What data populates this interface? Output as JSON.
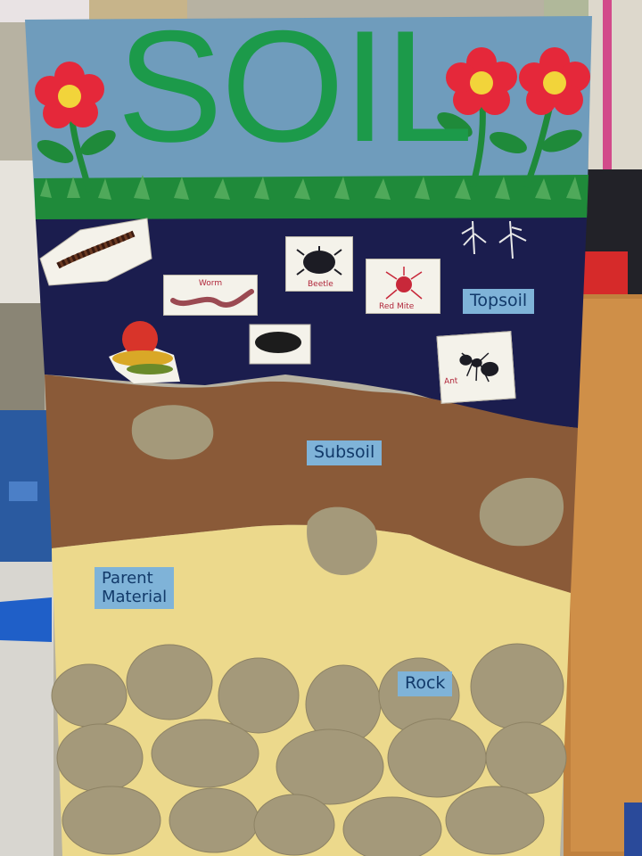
{
  "board": {
    "title": "SOIL"
  },
  "layers": {
    "topsoil": "Topsoil",
    "subsoil": "Subsoil",
    "parent_material": "Parent\nMaterial",
    "rock": "Rock"
  },
  "cards": [
    {
      "id": "worm",
      "caption": "Worm"
    },
    {
      "id": "beetle",
      "caption": "Beetle"
    },
    {
      "id": "red-mite",
      "caption": "Red Mite"
    },
    {
      "id": "ant",
      "caption": "Ant"
    }
  ],
  "colors": {
    "sky": "#6f9cbc",
    "grass": "#1f8a3a",
    "letters": "#1c9a4a",
    "topsoil": "#1b1d4e",
    "subsoil": "#8a5a38",
    "parent_material": "#ecd98c",
    "rock": "#9a8e6c",
    "flower_petal": "#e5283a",
    "flower_center": "#f2d43a",
    "label_bg": "#7fb3d8"
  }
}
